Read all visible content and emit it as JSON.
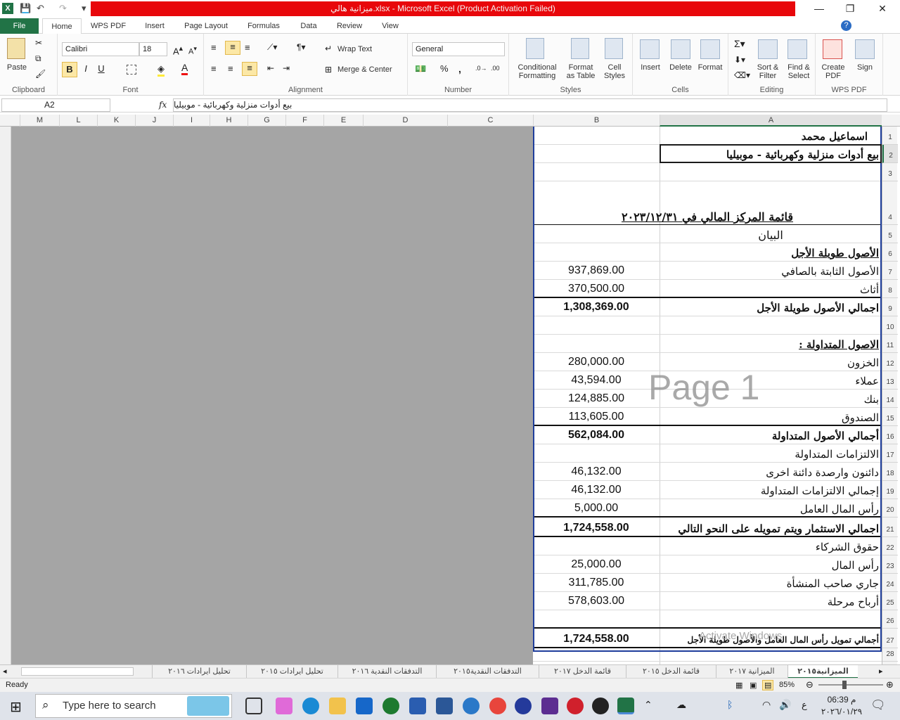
{
  "window": {
    "title": "ميزانية هالي.xlsx - Microsoft Excel (Product Activation Failed)",
    "controls": {
      "minimize": "—",
      "restore": "❐",
      "close": "✕"
    }
  },
  "tabs": [
    "File",
    "Home",
    "WPS PDF",
    "Insert",
    "Page Layout",
    "Formulas",
    "Data",
    "Review",
    "View"
  ],
  "ribbon": {
    "clipboard": {
      "label": "Clipboard",
      "paste": "Paste"
    },
    "font": {
      "label": "Font",
      "name": "Calibri",
      "size": "18",
      "bold": "B",
      "italic": "I",
      "underline": "U"
    },
    "alignment": {
      "label": "Alignment",
      "wrap": "Wrap Text",
      "merge": "Merge & Center"
    },
    "number": {
      "label": "Number",
      "format": "General",
      "percent": "%",
      "comma": ","
    },
    "styles": {
      "label": "Styles",
      "conditional": "Conditional\nFormatting",
      "format_table": "Format\nas Table",
      "cell_styles": "Cell\nStyles"
    },
    "cells": {
      "label": "Cells",
      "insert": "Insert",
      "delete": "Delete",
      "format": "Format"
    },
    "editing": {
      "label": "Editing",
      "sort": "Sort &\nFilter",
      "find": "Find &\nSelect"
    },
    "wpspdf": {
      "label": "WPS PDF",
      "create": "Create\nPDF",
      "sign": "Sign"
    }
  },
  "formula_bar": {
    "name_box": "A2",
    "fx": "fx",
    "content": "بيع أدوات منزلية وكهربائية - موبيليا"
  },
  "columns": [
    "M",
    "L",
    "K",
    "J",
    "I",
    "H",
    "G",
    "F",
    "E",
    "D",
    "C",
    "B",
    "A"
  ],
  "rows": [
    {
      "n": "1",
      "a": "اسماعيل  محمد",
      "b": "",
      "style": "bold"
    },
    {
      "n": "2",
      "a": "بيع أدوات منزلية وكهربائية - موبيليا",
      "b": "",
      "style": "bold"
    },
    {
      "n": "3",
      "a": "",
      "b": ""
    },
    {
      "n": "4",
      "a": "قائمة المركز المالي في ٢٠٢٣/١٢/٣١",
      "b": "",
      "style": "title"
    },
    {
      "n": "5",
      "a": "البيان",
      "b": ""
    },
    {
      "n": "6",
      "a": "الأصول طويلة الأجل",
      "b": "",
      "style": "bold-u"
    },
    {
      "n": "7",
      "a": "الأصول الثابتة بالصافي",
      "b": "937,869.00"
    },
    {
      "n": "8",
      "a": "أثاث",
      "b": "370,500.00"
    },
    {
      "n": "9",
      "a": "اجمالي الأصول طويلة الأجل",
      "b": "1,308,369.00",
      "style": "bold"
    },
    {
      "n": "10",
      "a": "",
      "b": ""
    },
    {
      "n": "11",
      "a": "الاصول المتداولة :",
      "b": "",
      "style": "bold-u"
    },
    {
      "n": "12",
      "a": "الخزون",
      "b": "280,000.00"
    },
    {
      "n": "13",
      "a": "عملاء",
      "b": "43,594.00"
    },
    {
      "n": "14",
      "a": "بنك",
      "b": "124,885.00"
    },
    {
      "n": "15",
      "a": "الصندوق",
      "b": "113,605.00"
    },
    {
      "n": "16",
      "a": "أجمالي الأصول المتداولة",
      "b": "562,084.00",
      "style": "bold"
    },
    {
      "n": "17",
      "a": "الالتزامات المتداولة",
      "b": ""
    },
    {
      "n": "18",
      "a": "دائنون وارصدة دائنة اخرى",
      "b": "46,132.00"
    },
    {
      "n": "19",
      "a": "إجمالي الالتزامات المتداولة",
      "b": "46,132.00"
    },
    {
      "n": "20",
      "a": "رأس المال العامل",
      "b": "5,000.00"
    },
    {
      "n": "21",
      "a": "اجمالي الاستثمار ويتم تمويله على النحو التالي",
      "b": "1,724,558.00",
      "style": "bold"
    },
    {
      "n": "22",
      "a": "حقوق الشركاء",
      "b": ""
    },
    {
      "n": "23",
      "a": "رأس المال",
      "b": "25,000.00"
    },
    {
      "n": "24",
      "a": "جاري صاحب المنشأة",
      "b": "311,785.00"
    },
    {
      "n": "25",
      "a": "أرباح مرحلة",
      "b": "578,603.00"
    },
    {
      "n": "26",
      "a": "",
      "b": ""
    },
    {
      "n": "27",
      "a": "أجمالي تمويل رأس المال العامل والأصول طويلة الأجل",
      "b": "1,724,558.00",
      "style": "bold-small"
    },
    {
      "n": "28",
      "a": "",
      "b": ""
    }
  ],
  "watermark": {
    "page": "Page 1",
    "activate": "Activate Windows"
  },
  "sheet_tabs": [
    "الميزانية٢٠١٥",
    "الميزانية ٢٠١٧",
    "قائمة الدخل ٢٠١٥",
    "قائمة الدخل ٢٠١٧",
    "التدفقات النقدية٢٠١٥",
    "التدفقات النقدية ٢٠١٦",
    "تحليل ايرادات ٢٠١٥",
    "تحليل ايرادات ٢٠١٦"
  ],
  "status": {
    "ready": "Ready",
    "zoom": "85%"
  },
  "taskbar": {
    "search_placeholder": "Type here to search",
    "time": "06:39 م",
    "date": "٢٠٢٦/٠١/٢٩",
    "lang": "ع"
  },
  "colors": {
    "excel_green": "#217346",
    "title_red": "#e8070b",
    "accent_blue": "#1f3e9c"
  }
}
